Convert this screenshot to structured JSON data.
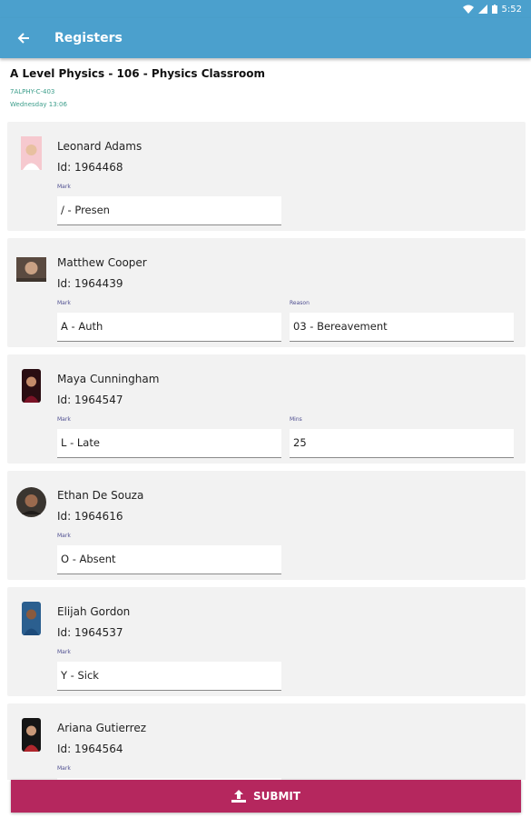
{
  "status_bar": {
    "time": "5:52"
  },
  "app_bar": {
    "title": "Registers"
  },
  "class": {
    "title": "A Level Physics - 106 - Physics Classroom",
    "code": "7ALPHY-C-403",
    "time": "Wednesday 13:06"
  },
  "students": [
    {
      "name": "Leonard Adams",
      "id": "Id: 1964468",
      "mark_label": "Mark",
      "mark": "/ - Presen",
      "extra_label": "",
      "extra": ""
    },
    {
      "name": "Matthew Cooper",
      "id": "Id: 1964439",
      "mark_label": "Mark",
      "mark": "A - Auth",
      "extra_label": "Reason",
      "extra": "03 - Bereavement"
    },
    {
      "name": "Maya Cunningham",
      "id": "Id: 1964547",
      "mark_label": "Mark",
      "mark": "L - Late",
      "extra_label": "Mins",
      "extra": "25"
    },
    {
      "name": "Ethan De Souza",
      "id": "Id: 1964616",
      "mark_label": "Mark",
      "mark": "O - Absent",
      "extra_label": "",
      "extra": ""
    },
    {
      "name": "Elijah Gordon",
      "id": "Id: 1964537",
      "mark_label": "Mark",
      "mark": "Y - Sick",
      "extra_label": "",
      "extra": ""
    },
    {
      "name": "Ariana Gutierrez",
      "id": "Id: 1964564",
      "mark_label": "Mark",
      "mark": "",
      "extra_label": "",
      "extra": ""
    }
  ],
  "submit": {
    "label": "SUBMIT"
  },
  "colors": {
    "primary": "#4ba0cd",
    "accent": "#b5275e",
    "card": "#f2f2f2",
    "subtext": "#3b9d8a"
  }
}
